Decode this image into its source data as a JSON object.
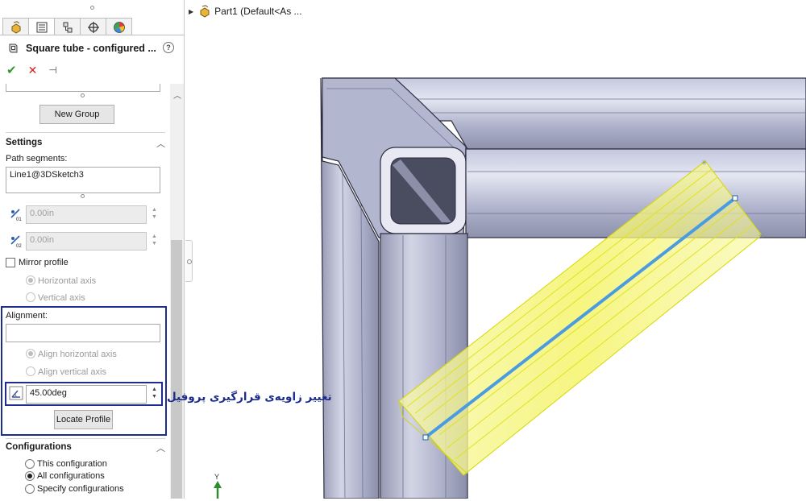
{
  "header": {
    "title": "Square tube - configured ...",
    "help": "?"
  },
  "tabs": [
    {
      "icon": "feature-manager-icon"
    },
    {
      "icon": "property-manager-icon"
    },
    {
      "icon": "configuration-manager-icon"
    },
    {
      "icon": "dimxpert-icon"
    },
    {
      "icon": "display-manager-icon"
    }
  ],
  "actions": {
    "ok": "✔",
    "cancel": "✕",
    "pin": "⊣"
  },
  "groups": {
    "new_group_label": "New Group"
  },
  "settings": {
    "heading": "Settings",
    "path_segments_label": "Path segments:",
    "path_segments_value": "Line1@3DSketch3",
    "offset1_value": "0.00in",
    "offset2_value": "0.00in",
    "mirror_label": "Mirror profile",
    "mirror_checked": false,
    "horizontal_axis_label": "Horizontal axis",
    "vertical_axis_label": "Vertical axis",
    "alignment_label": "Alignment:",
    "alignment_value": "",
    "align_horizontal_label": "Align horizontal axis",
    "align_vertical_label": "Align vertical axis",
    "angle_value": "45.00deg",
    "locate_profile_label": "Locate Profile"
  },
  "configurations": {
    "heading": "Configurations",
    "options": [
      {
        "label": "This configuration",
        "selected": false
      },
      {
        "label": "All configurations",
        "selected": true
      },
      {
        "label": "Specify configurations",
        "selected": false
      }
    ]
  },
  "annotation": {
    "text": "تغییر زاویه‌ی قرارگیری پروفیل",
    "color": "#1d2d8f"
  },
  "tree": {
    "part_label": "Part1  (Default<As ..."
  },
  "triad": {
    "axis_label": "Y"
  },
  "colors": {
    "accent_blue": "#1d2d8f",
    "ok_green": "#2e9a2e",
    "cancel_red": "#d32222",
    "preview_yellow": "#f2f25a",
    "path_blue": "#4a9be0",
    "tube_gray": "#a7abc2"
  }
}
